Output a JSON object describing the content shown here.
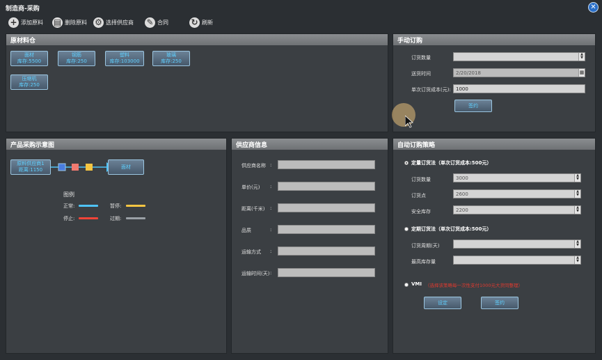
{
  "window": {
    "title": "制造商-采购"
  },
  "toolbar": {
    "add_material": "添加原料",
    "delete_material": "删除原料",
    "choose_supplier": "选择供应商",
    "contract": "合同",
    "refresh": "刷新"
  },
  "warehouse": {
    "title": "原材料仓",
    "materials": [
      {
        "name": "面材",
        "stock": "库存:5500"
      },
      {
        "name": "钢筋",
        "stock": "库存:250"
      },
      {
        "name": "塑料",
        "stock": "库存:103000"
      },
      {
        "name": "玻璃",
        "stock": "库存:250"
      },
      {
        "name": "压缩机",
        "stock": "库存:250"
      }
    ]
  },
  "manual_order": {
    "title": "手动订购",
    "qty_label": "订货数量",
    "qty_value": "",
    "time_label": "送货时间",
    "time_value": "2/20/2018",
    "cost_label": "单次订货成本(元):",
    "cost_value": "1000",
    "sign_button": "签约"
  },
  "diagram": {
    "title": "产品采购示意图",
    "supplier_name": "原料供应商1",
    "supplier_dist": "距离:1150",
    "target": "面材",
    "legend_title": "图例",
    "legend": [
      {
        "label": "正常:",
        "color": "#4fc3f7"
      },
      {
        "label": "暂停:",
        "color": "#f5c542"
      },
      {
        "label": "停止:",
        "color": "#f04438"
      },
      {
        "label": "过期:",
        "color": "#9aa0a6"
      }
    ],
    "colors": {
      "box1": "#4a7de0",
      "box2": "#f07a70",
      "box3": "#f5c542",
      "line": "#4fc3f7"
    }
  },
  "supplier": {
    "title": "供应商信息",
    "fields": [
      {
        "label": "供应商名称",
        "value": ""
      },
      {
        "label": "单价(元)",
        "value": ""
      },
      {
        "label": "距离(千米)",
        "value": ""
      },
      {
        "label": "品质",
        "value": ""
      },
      {
        "label": "运输方式",
        "value": ""
      },
      {
        "label": "运输时间(天)",
        "value": ""
      }
    ],
    "colon": ":"
  },
  "auto_order": {
    "title": "自动订购策略",
    "fixed_qty_title": "定量订货法（单次订货成本:500元）",
    "order_qty_label": "订货数量",
    "order_qty_value": "3000",
    "reorder_label": "订货点",
    "reorder_value": "2600",
    "safety_label": "安全库存",
    "safety_value": "2200",
    "fixed_period_title": "定期订货法（单次订货成本:500元）",
    "period_label": "订货周期(天)",
    "period_value": "",
    "max_stock_label": "最高库存量",
    "max_stock_value": "",
    "vmi_label": "VMI",
    "vmi_note": "（选择该策略每一次性支付1000元大货同整理）",
    "vmi_note_color": "#e03a2f",
    "confirm_button": "设定",
    "sign_button": "签约"
  }
}
